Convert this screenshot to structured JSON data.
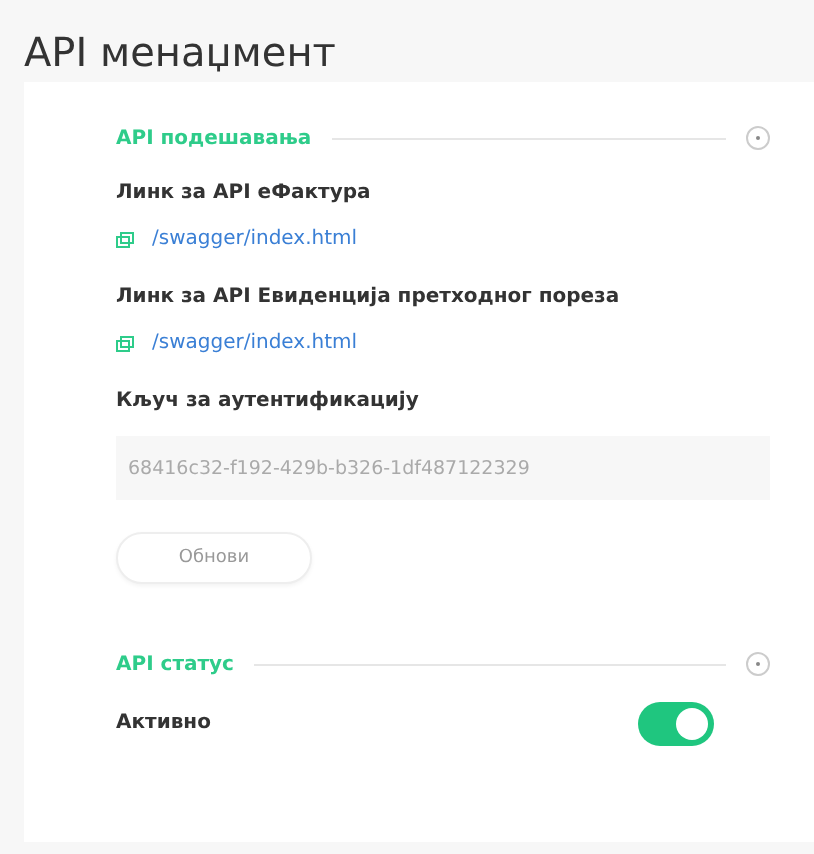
{
  "title": "API менаџмент",
  "sections": [
    {
      "title": "API подешавања",
      "items": [
        {
          "kind": "link",
          "label": "Линк за API еФактура",
          "value": "/swagger/index.html"
        },
        {
          "kind": "link",
          "label": "Линк за API Евиденција претходног пореза",
          "value": "/swagger/index.html"
        },
        {
          "kind": "field",
          "label": "Кључ за аутентификацију",
          "value": "68416c32-f192-429b-b326-1df487122329"
        },
        {
          "kind": "button",
          "label": "Обнови"
        }
      ]
    },
    {
      "title": "API статус",
      "items": [
        {
          "kind": "toggle",
          "label": "Активно",
          "on": true
        }
      ]
    }
  ]
}
